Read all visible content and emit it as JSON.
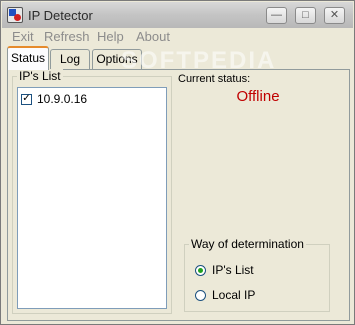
{
  "window": {
    "title": "IP Detector",
    "controls": {
      "minimize": "—",
      "maximize": "□",
      "close": "✕"
    }
  },
  "menu": [
    "Exit",
    "Refresh",
    "Help",
    "About"
  ],
  "tabs": [
    {
      "label": "Status",
      "active": true
    },
    {
      "label": "Log",
      "active": false
    },
    {
      "label": "Options",
      "active": false
    }
  ],
  "ip_list": {
    "title": "IP's List",
    "items": [
      {
        "ip": "10.9.0.16",
        "checked": true
      }
    ]
  },
  "status": {
    "label": "Current status:",
    "value": "Offline",
    "value_color": "#c00000"
  },
  "determination": {
    "title": "Way of determination",
    "options": [
      {
        "label": "IP's List",
        "selected": true
      },
      {
        "label": "Local IP",
        "selected": false
      }
    ]
  },
  "watermark": "SOFTPEDIA"
}
